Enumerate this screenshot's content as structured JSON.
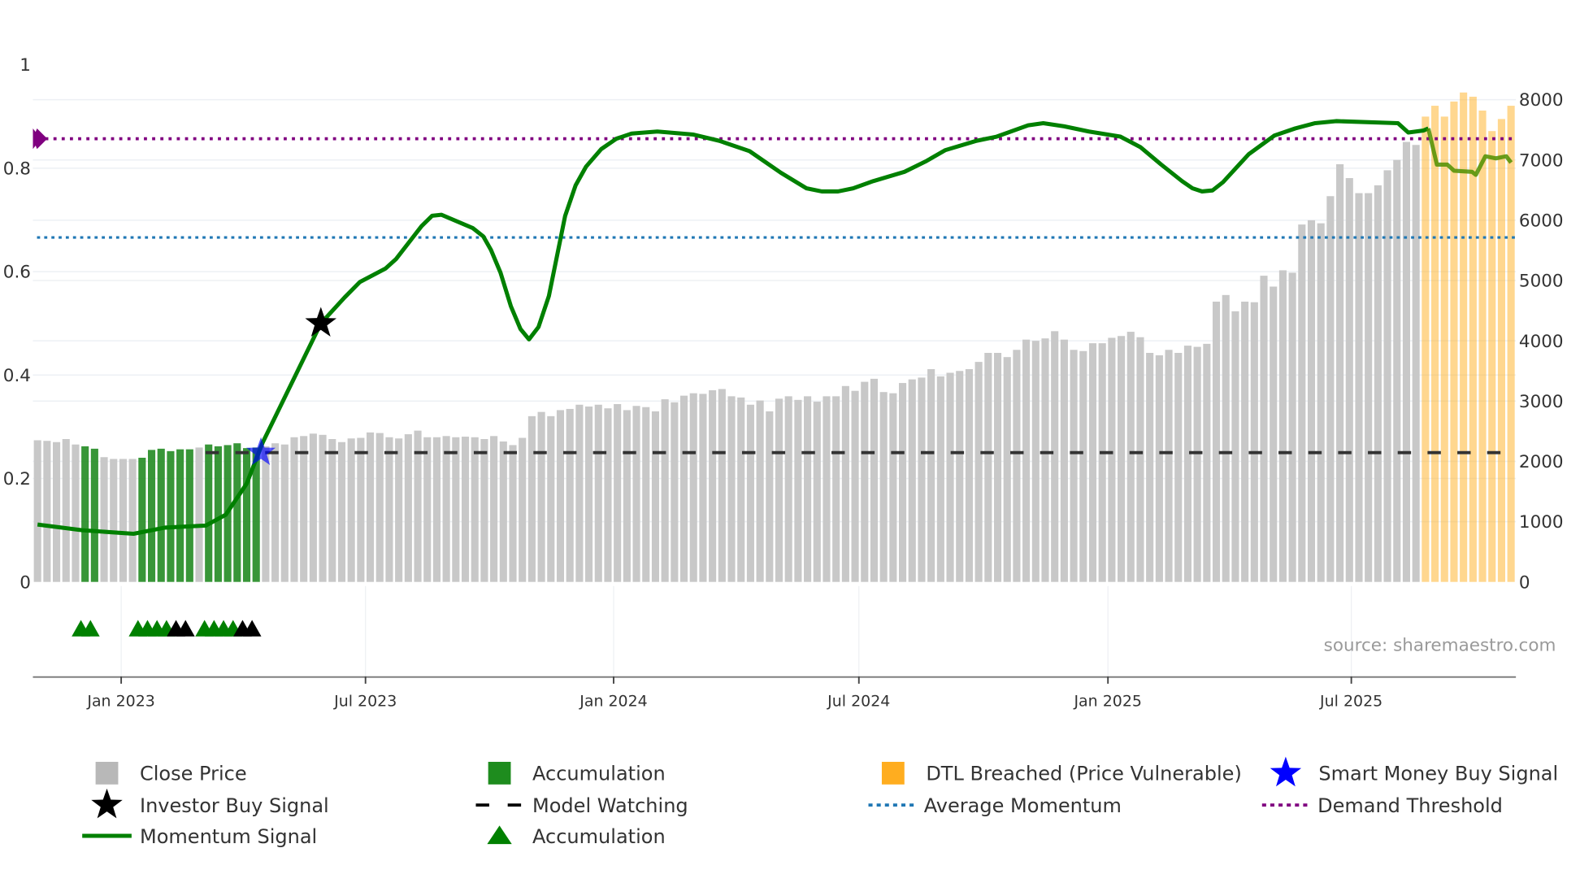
{
  "chart_data": {
    "type": "bar",
    "title": "",
    "source": "source: sharemaestro.com",
    "x_unit": "week index (weekly bars)",
    "x_ticks": [
      {
        "label": "Jan 2023",
        "week": 8.8
      },
      {
        "label": "Jul 2023",
        "week": 34.5
      },
      {
        "label": "Jan 2024",
        "week": 60.6
      },
      {
        "label": "Jul 2024",
        "week": 86.4
      },
      {
        "label": "Jan 2025",
        "week": 112.6
      },
      {
        "label": "Jul 2025",
        "week": 138.2
      }
    ],
    "left_axis": {
      "range": [
        0,
        1
      ],
      "ticks": [
        "0",
        "0.2",
        "0.4",
        "0.6",
        "0.8",
        "1"
      ]
    },
    "right_axis": {
      "range": [
        0,
        8000
      ],
      "ticks": [
        "0",
        "1000",
        "2000",
        "3000",
        "4000",
        "5000",
        "6000",
        "7000",
        "8000"
      ]
    },
    "close_price": [
      2350,
      2340,
      2320,
      2370,
      2280,
      2250,
      2210,
      2070,
      2040,
      2040,
      2040,
      2060,
      2190,
      2210,
      2170,
      2200,
      2200,
      2230,
      2280,
      2250,
      2270,
      2300,
      2220,
      2230,
      2250,
      2300,
      2280,
      2400,
      2420,
      2460,
      2440,
      2370,
      2320,
      2380,
      2390,
      2480,
      2470,
      2400,
      2380,
      2450,
      2510,
      2400,
      2400,
      2420,
      2400,
      2410,
      2400,
      2370,
      2420,
      2330,
      2270,
      2390,
      2750,
      2820,
      2750,
      2850,
      2870,
      2940,
      2910,
      2940,
      2880,
      2950,
      2850,
      2920,
      2900,
      2830,
      3030,
      2980,
      3090,
      3130,
      3120,
      3180,
      3200,
      3080,
      3060,
      2940,
      3010,
      2830,
      3040,
      3080,
      3020,
      3080,
      2990,
      3080,
      3080,
      3250,
      3170,
      3320,
      3370,
      3150,
      3130,
      3300,
      3360,
      3390,
      3530,
      3410,
      3470,
      3500,
      3530,
      3650,
      3800,
      3800,
      3730,
      3850,
      4020,
      4000,
      4040,
      4160,
      4020,
      3850,
      3830,
      3960,
      3960,
      4050,
      4080,
      4150,
      4060,
      3800,
      3760,
      3850,
      3800,
      3920,
      3900,
      3950,
      4650,
      4760,
      4490,
      4650,
      4640,
      5080,
      4900,
      5170,
      5130,
      5930,
      6000,
      5950,
      6400,
      6930,
      6700,
      6450,
      6450,
      6580,
      6830,
      7000,
      7300,
      7250,
      7720,
      7900,
      7720,
      7970,
      8120,
      8050,
      7820,
      7480,
      7680,
      7900
    ],
    "accumulation_bar_weeks": [
      5,
      6,
      11,
      12,
      13,
      14,
      15,
      16,
      18,
      19,
      20,
      21,
      22,
      23
    ],
    "dtl_breached_weeks": [
      146,
      147,
      148,
      149,
      150,
      151,
      152,
      153,
      154,
      155
    ],
    "momentum_signal": [
      [
        0,
        0.111
      ],
      [
        4.7,
        0.1
      ],
      [
        10.1,
        0.093
      ],
      [
        13.4,
        0.105
      ],
      [
        17.7,
        0.109
      ],
      [
        19.8,
        0.13
      ],
      [
        22.0,
        0.19
      ],
      [
        23.7,
        0.27
      ],
      [
        29.8,
        0.5
      ],
      [
        32.3,
        0.55
      ],
      [
        33.9,
        0.58
      ],
      [
        36.6,
        0.606
      ],
      [
        37.7,
        0.624
      ],
      [
        40.4,
        0.688
      ],
      [
        41.5,
        0.708
      ],
      [
        42.5,
        0.71
      ],
      [
        45.8,
        0.684
      ],
      [
        46.9,
        0.668
      ],
      [
        47.7,
        0.642
      ],
      [
        48.7,
        0.598
      ],
      [
        49.8,
        0.533
      ],
      [
        50.8,
        0.489
      ],
      [
        51.7,
        0.469
      ],
      [
        52.7,
        0.493
      ],
      [
        53.8,
        0.553
      ],
      [
        55.5,
        0.708
      ],
      [
        56.6,
        0.767
      ],
      [
        57.7,
        0.803
      ],
      [
        59.3,
        0.837
      ],
      [
        60.9,
        0.857
      ],
      [
        62.5,
        0.867
      ],
      [
        65.2,
        0.871
      ],
      [
        69.0,
        0.865
      ],
      [
        71.7,
        0.853
      ],
      [
        74.9,
        0.833
      ],
      [
        78.2,
        0.791
      ],
      [
        80.9,
        0.761
      ],
      [
        82.5,
        0.755
      ],
      [
        84.2,
        0.755
      ],
      [
        85.8,
        0.761
      ],
      [
        87.9,
        0.775
      ],
      [
        91.2,
        0.793
      ],
      [
        93.4,
        0.813
      ],
      [
        95.5,
        0.835
      ],
      [
        98.8,
        0.853
      ],
      [
        100.9,
        0.861
      ],
      [
        104.2,
        0.883
      ],
      [
        105.8,
        0.887
      ],
      [
        108.0,
        0.881
      ],
      [
        110.6,
        0.871
      ],
      [
        113.9,
        0.861
      ],
      [
        116.0,
        0.841
      ],
      [
        118.2,
        0.807
      ],
      [
        120.4,
        0.775
      ],
      [
        121.5,
        0.761
      ],
      [
        122.5,
        0.755
      ],
      [
        123.6,
        0.757
      ],
      [
        124.7,
        0.773
      ],
      [
        127.4,
        0.827
      ],
      [
        130.1,
        0.863
      ],
      [
        132.3,
        0.877
      ],
      [
        134.4,
        0.887
      ],
      [
        136.6,
        0.891
      ],
      [
        143.1,
        0.887
      ],
      [
        144.2,
        0.869
      ],
      [
        145.8,
        0.873
      ],
      [
        146.3,
        0.877
      ],
      [
        147.2,
        0.807
      ],
      [
        148.3,
        0.807
      ],
      [
        149.0,
        0.795
      ],
      [
        150.9,
        0.793
      ],
      [
        151.3,
        0.787
      ],
      [
        152.3,
        0.823
      ],
      [
        153.4,
        0.819
      ],
      [
        154.5,
        0.823
      ],
      [
        155.0,
        0.811
      ]
    ],
    "demand_threshold": 0.857,
    "average_momentum": 0.666,
    "model_watching": {
      "value": 0.25,
      "from_week": 18
    },
    "smart_money_buy_signal": {
      "week": 23.5,
      "value": 0.25
    },
    "investor_buy_signal": {
      "week": 29.8,
      "value": 0.5
    },
    "accumulation_markers": [
      {
        "week": 5,
        "color": "green"
      },
      {
        "week": 6,
        "color": "green"
      },
      {
        "week": 11,
        "color": "green"
      },
      {
        "week": 12,
        "color": "green"
      },
      {
        "week": 13,
        "color": "green"
      },
      {
        "week": 14,
        "color": "green"
      },
      {
        "week": 15,
        "color": "black"
      },
      {
        "week": 16,
        "color": "black"
      },
      {
        "week": 18,
        "color": "green"
      },
      {
        "week": 19,
        "color": "green"
      },
      {
        "week": 20,
        "color": "green"
      },
      {
        "week": 21,
        "color": "green"
      },
      {
        "week": 22,
        "color": "black"
      },
      {
        "week": 23,
        "color": "black"
      }
    ],
    "colors": {
      "price": "#c8c8c8",
      "accumulation": "#228b22",
      "dtl": "#ffb020",
      "momentum": "#008000",
      "demand": "#800080",
      "average": "#1f77b4",
      "smart": "#0000ff"
    },
    "legend": [
      {
        "label": "Close Price",
        "symbol": "gray-square"
      },
      {
        "label": "Accumulation",
        "symbol": "green-square"
      },
      {
        "label": "DTL Breached (Price Vulnerable)",
        "symbol": "orange-square"
      },
      {
        "label": "Smart Money Buy Signal",
        "symbol": "blue-star"
      },
      {
        "label": "Investor Buy Signal",
        "symbol": "black-star"
      },
      {
        "label": "Model Watching",
        "symbol": "black-dash"
      },
      {
        "label": "Average Momentum",
        "symbol": "blue-dot"
      },
      {
        "label": "Demand Threshold",
        "symbol": "purple-dot"
      },
      {
        "label": "Momentum Signal",
        "symbol": "green-line"
      },
      {
        "label": "Accumulation",
        "symbol": "green-triangle"
      }
    ]
  }
}
